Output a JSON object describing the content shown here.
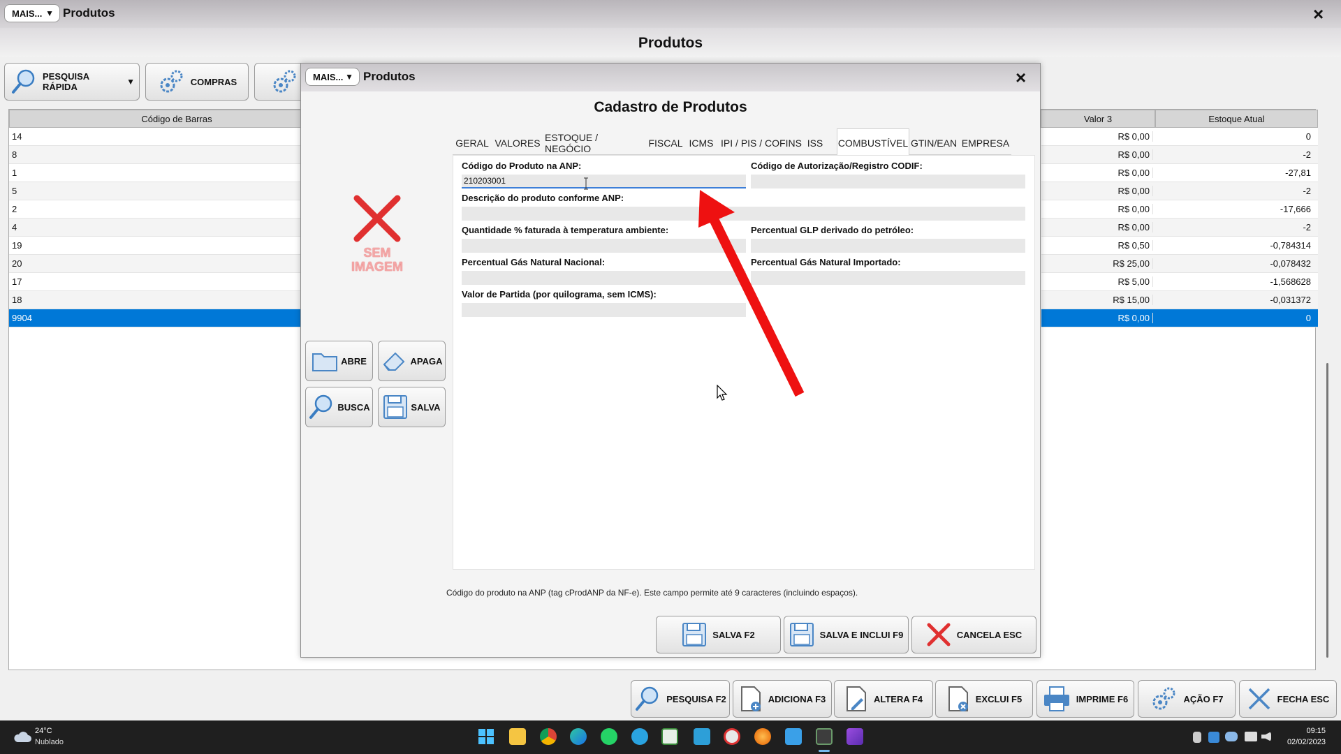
{
  "main_window": {
    "mais_label": "MAIS...",
    "title": "Produtos",
    "header_title": "Produtos",
    "toolbar": {
      "pesquisa_rapida": "PESQUISA RÁPIDA",
      "compras": "COMPRAS"
    },
    "grid": {
      "col_codigo": "Código de Barras",
      "col_valor3": "Valor 3",
      "col_estoque": "Estoque Atual",
      "rows": [
        {
          "codigo": "14",
          "valor3": "R$ 0,00",
          "estoque": "0"
        },
        {
          "codigo": "8",
          "valor3": "R$ 0,00",
          "estoque": "-2"
        },
        {
          "codigo": "1",
          "valor3": "R$ 0,00",
          "estoque": "-27,81"
        },
        {
          "codigo": "5",
          "valor3": "R$ 0,00",
          "estoque": "-2"
        },
        {
          "codigo": "2",
          "valor3": "R$ 0,00",
          "estoque": "-17,666"
        },
        {
          "codigo": "4",
          "valor3": "R$ 0,00",
          "estoque": "-2"
        },
        {
          "codigo": "19",
          "valor3": "R$ 0,50",
          "estoque": "-0,784314"
        },
        {
          "codigo": "20",
          "valor3": "R$ 25,00",
          "estoque": "-0,078432"
        },
        {
          "codigo": "17",
          "valor3": "R$ 5,00",
          "estoque": "-1,568628"
        },
        {
          "codigo": "18",
          "valor3": "R$ 15,00",
          "estoque": "-0,031372"
        },
        {
          "codigo": "9904",
          "valor3": "R$ 0,00",
          "estoque": "0"
        }
      ]
    },
    "bottom_buttons": {
      "pesquisa": "PESQUISA F2",
      "adiciona": "ADICIONA F3",
      "altera": "ALTERA F4",
      "exclui": "EXCLUI F5",
      "imprime": "IMPRIME F6",
      "acao": "AÇÃO F7",
      "fecha": "FECHA ESC"
    },
    "close_glyph": "×"
  },
  "dialog": {
    "mais_label": "MAIS...",
    "title": "Produtos",
    "close_glyph": "×",
    "header_title": "Cadastro de Produtos",
    "image_placeholder": {
      "line1": "SEM",
      "line2": "IMAGEM"
    },
    "image_buttons": {
      "abre": "ABRE",
      "apaga": "APAGA",
      "busca": "BUSCA",
      "salva": "SALVA"
    },
    "tabs": [
      "GERAL",
      "VALORES",
      "ESTOQUE / NEGÓCIO",
      "FISCAL",
      "ICMS",
      "IPI / PIS / COFINS",
      "ISS",
      "COMBUSTÍVEL",
      "GTIN/EAN",
      "EMPRESA"
    ],
    "active_tab": "COMBUSTÍVEL",
    "fields": {
      "codigo_anp_label": "Código do Produto na ANP:",
      "codigo_anp_value": "210203001",
      "codif_label": "Código de Autorização/Registro CODIF:",
      "codif_value": "",
      "descricao_label": "Descrição do produto conforme ANP:",
      "descricao_value": "",
      "quantidade_label": "Quantidade % faturada à temperatura ambiente:",
      "quantidade_value": "",
      "glp_label": "Percentual GLP derivado do petróleo:",
      "glp_value": "",
      "gas_nacional_label": "Percentual Gás Natural Nacional:",
      "gas_nacional_value": "",
      "gas_importado_label": "Percentual Gás Natural Importado:",
      "gas_importado_value": "",
      "valor_partida_label": "Valor de Partida (por quilograma, sem ICMS):",
      "valor_partida_value": ""
    },
    "hint": "Código do produto na ANP (tag cProdANP da NF-e). Este campo permite até 9 caracteres (incluindo espaços).",
    "footer_buttons": {
      "salva": "SALVA F2",
      "salva_inclui": "SALVA E INCLUI F9",
      "cancela": "CANCELA ESC"
    }
  },
  "taskbar": {
    "weather_temp": "24°C",
    "weather_desc": "Nublado",
    "time": "09:15",
    "date": "02/02/2023"
  },
  "colors": {
    "selection": "#0078d7",
    "arrow": "#ee1111",
    "taskbar": "#1f1f1f"
  }
}
